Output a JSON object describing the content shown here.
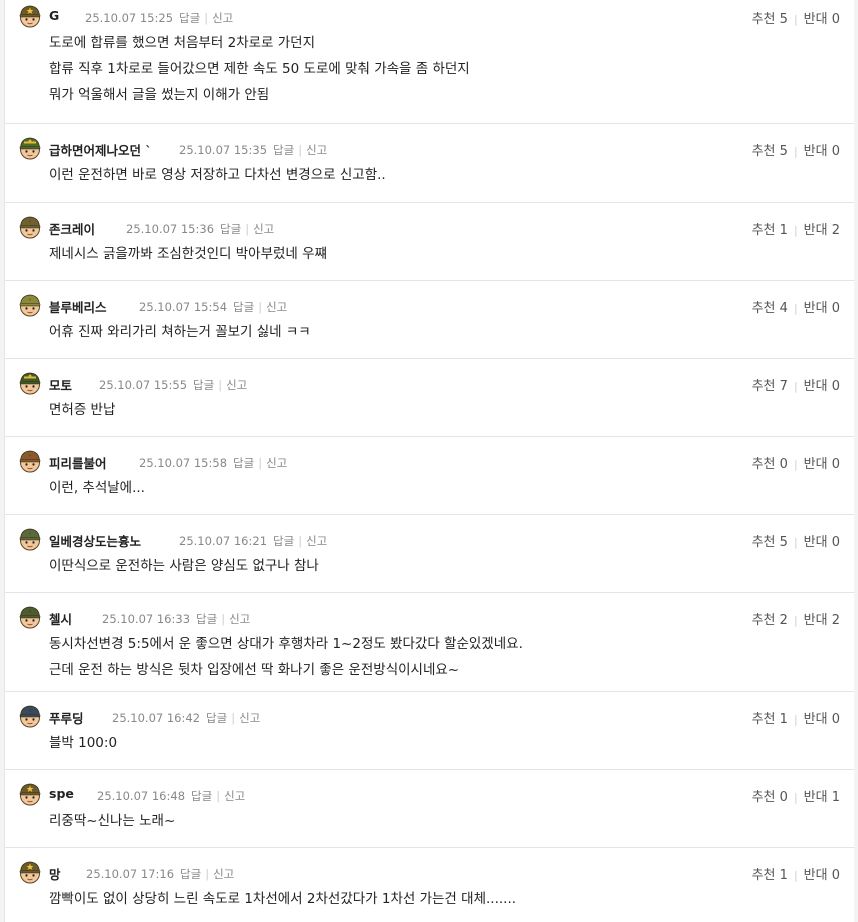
{
  "comments": [
    {
      "nick": "G",
      "date": "25.10.07 15:25",
      "reply": "답글",
      "report": "신고",
      "up_label": "추천",
      "up": "5",
      "down_label": "반대",
      "down": "0",
      "lines": [
        "도로에 합류를 했으면 처음부터 2차로로 가던지",
        "합류 직후 1차로로 들어갔으면 제한 속도 50 도로에 맞춰 가속을 좀 하던지",
        "뭐가 억울해서 글을 썼는지 이해가 안됨"
      ],
      "avatar": {
        "kind": "officer",
        "hat": "#6b5a2a",
        "skin": "#f2c79a"
      }
    },
    {
      "nick": "급하면어제나오던 ˋ",
      "date": "25.10.07 15:35",
      "reply": "답글",
      "report": "신고",
      "up_label": "추천",
      "up": "5",
      "down_label": "반대",
      "down": "0",
      "lines": [
        "이런 운전하면 바로 영상 저장하고 다차선 변경으로 신고함.."
      ],
      "avatar": {
        "kind": "general",
        "hat": "#4a6b2a",
        "skin": "#f2c79a"
      }
    },
    {
      "nick": "존크레이",
      "date": "25.10.07 15:36",
      "reply": "답글",
      "report": "신고",
      "up_label": "추천",
      "up": "1",
      "down_label": "반대",
      "down": "2",
      "lines": [
        "제네시스 긁을까봐 조심한것인디 박아부렀네 우쨰"
      ],
      "avatar": {
        "kind": "soldier",
        "hat": "#6d6230",
        "skin": "#f2c79a"
      }
    },
    {
      "nick": "블루베리스",
      "date": "25.10.07 15:54",
      "reply": "답글",
      "report": "신고",
      "up_label": "추천",
      "up": "4",
      "down_label": "반대",
      "down": "0",
      "lines": [
        "어휴 진짜 와리가리 쳐하는거 꼴보기 싫네 ㅋㅋ"
      ],
      "avatar": {
        "kind": "soldier",
        "hat": "#8a8a3a",
        "skin": "#f2c79a"
      }
    },
    {
      "nick": "모토",
      "date": "25.10.07 15:55",
      "reply": "답글",
      "report": "신고",
      "up_label": "추천",
      "up": "7",
      "down_label": "반대",
      "down": "0",
      "lines": [
        "면허증 반납"
      ],
      "avatar": {
        "kind": "general",
        "hat": "#3f5a26",
        "skin": "#f2c79a"
      }
    },
    {
      "nick": "피리를불어",
      "date": "25.10.07 15:58",
      "reply": "답글",
      "report": "신고",
      "up_label": "추천",
      "up": "0",
      "down_label": "반대",
      "down": "0",
      "lines": [
        "이런, 추석날에..."
      ],
      "avatar": {
        "kind": "soldier",
        "hat": "#8a5a2a",
        "skin": "#f2c79a"
      }
    },
    {
      "nick": "일베경상도는흉노",
      "date": "25.10.07 16:21",
      "reply": "답글",
      "report": "신고",
      "up_label": "추천",
      "up": "5",
      "down_label": "반대",
      "down": "0",
      "lines": [
        "이딴식으로 운전하는 사람은 양심도 없구나 참나"
      ],
      "avatar": {
        "kind": "soldier",
        "hat": "#5a6a3a",
        "skin": "#f2c79a"
      }
    },
    {
      "nick": "첼시",
      "date": "25.10.07 16:33",
      "reply": "답글",
      "report": "신고",
      "up_label": "추천",
      "up": "2",
      "down_label": "반대",
      "down": "2",
      "lines": [
        "동시차선변경 5:5에서 운 좋으면 상대가 후행차라 1~2정도 봤다갔다 할순있겠네요.",
        "근데 운전 하는 방식은 뒷차 입장에선 딱 화나기 좋은 운전방식이시네요~"
      ],
      "avatar": {
        "kind": "soldier",
        "hat": "#4e5a30",
        "skin": "#f2c79a"
      }
    },
    {
      "nick": "푸루딩",
      "date": "25.10.07 16:42",
      "reply": "답글",
      "report": "신고",
      "up_label": "추천",
      "up": "1",
      "down_label": "반대",
      "down": "0",
      "lines": [
        "블박 100:0"
      ],
      "avatar": {
        "kind": "soldier",
        "hat": "#3a4a5a",
        "skin": "#f2c79a"
      }
    },
    {
      "nick": "spe",
      "date": "25.10.07 16:48",
      "reply": "답글",
      "report": "신고",
      "up_label": "추천",
      "up": "0",
      "down_label": "반대",
      "down": "1",
      "lines": [
        "리중딱~신나는 노래~"
      ],
      "avatar": {
        "kind": "officer",
        "hat": "#6b5a2a",
        "skin": "#f2c79a"
      }
    },
    {
      "nick": "망",
      "date": "25.10.07 17:16",
      "reply": "답글",
      "report": "신고",
      "up_label": "추천",
      "up": "1",
      "down_label": "반대",
      "down": "0",
      "lines": [
        "깜빡이도 없이 상당히 느린 속도로 1차선에서 2차선갔다가 1차선 가는건 대체......."
      ],
      "avatar": {
        "kind": "officer",
        "hat": "#6b5a2a",
        "skin": "#f2c79a"
      }
    }
  ]
}
